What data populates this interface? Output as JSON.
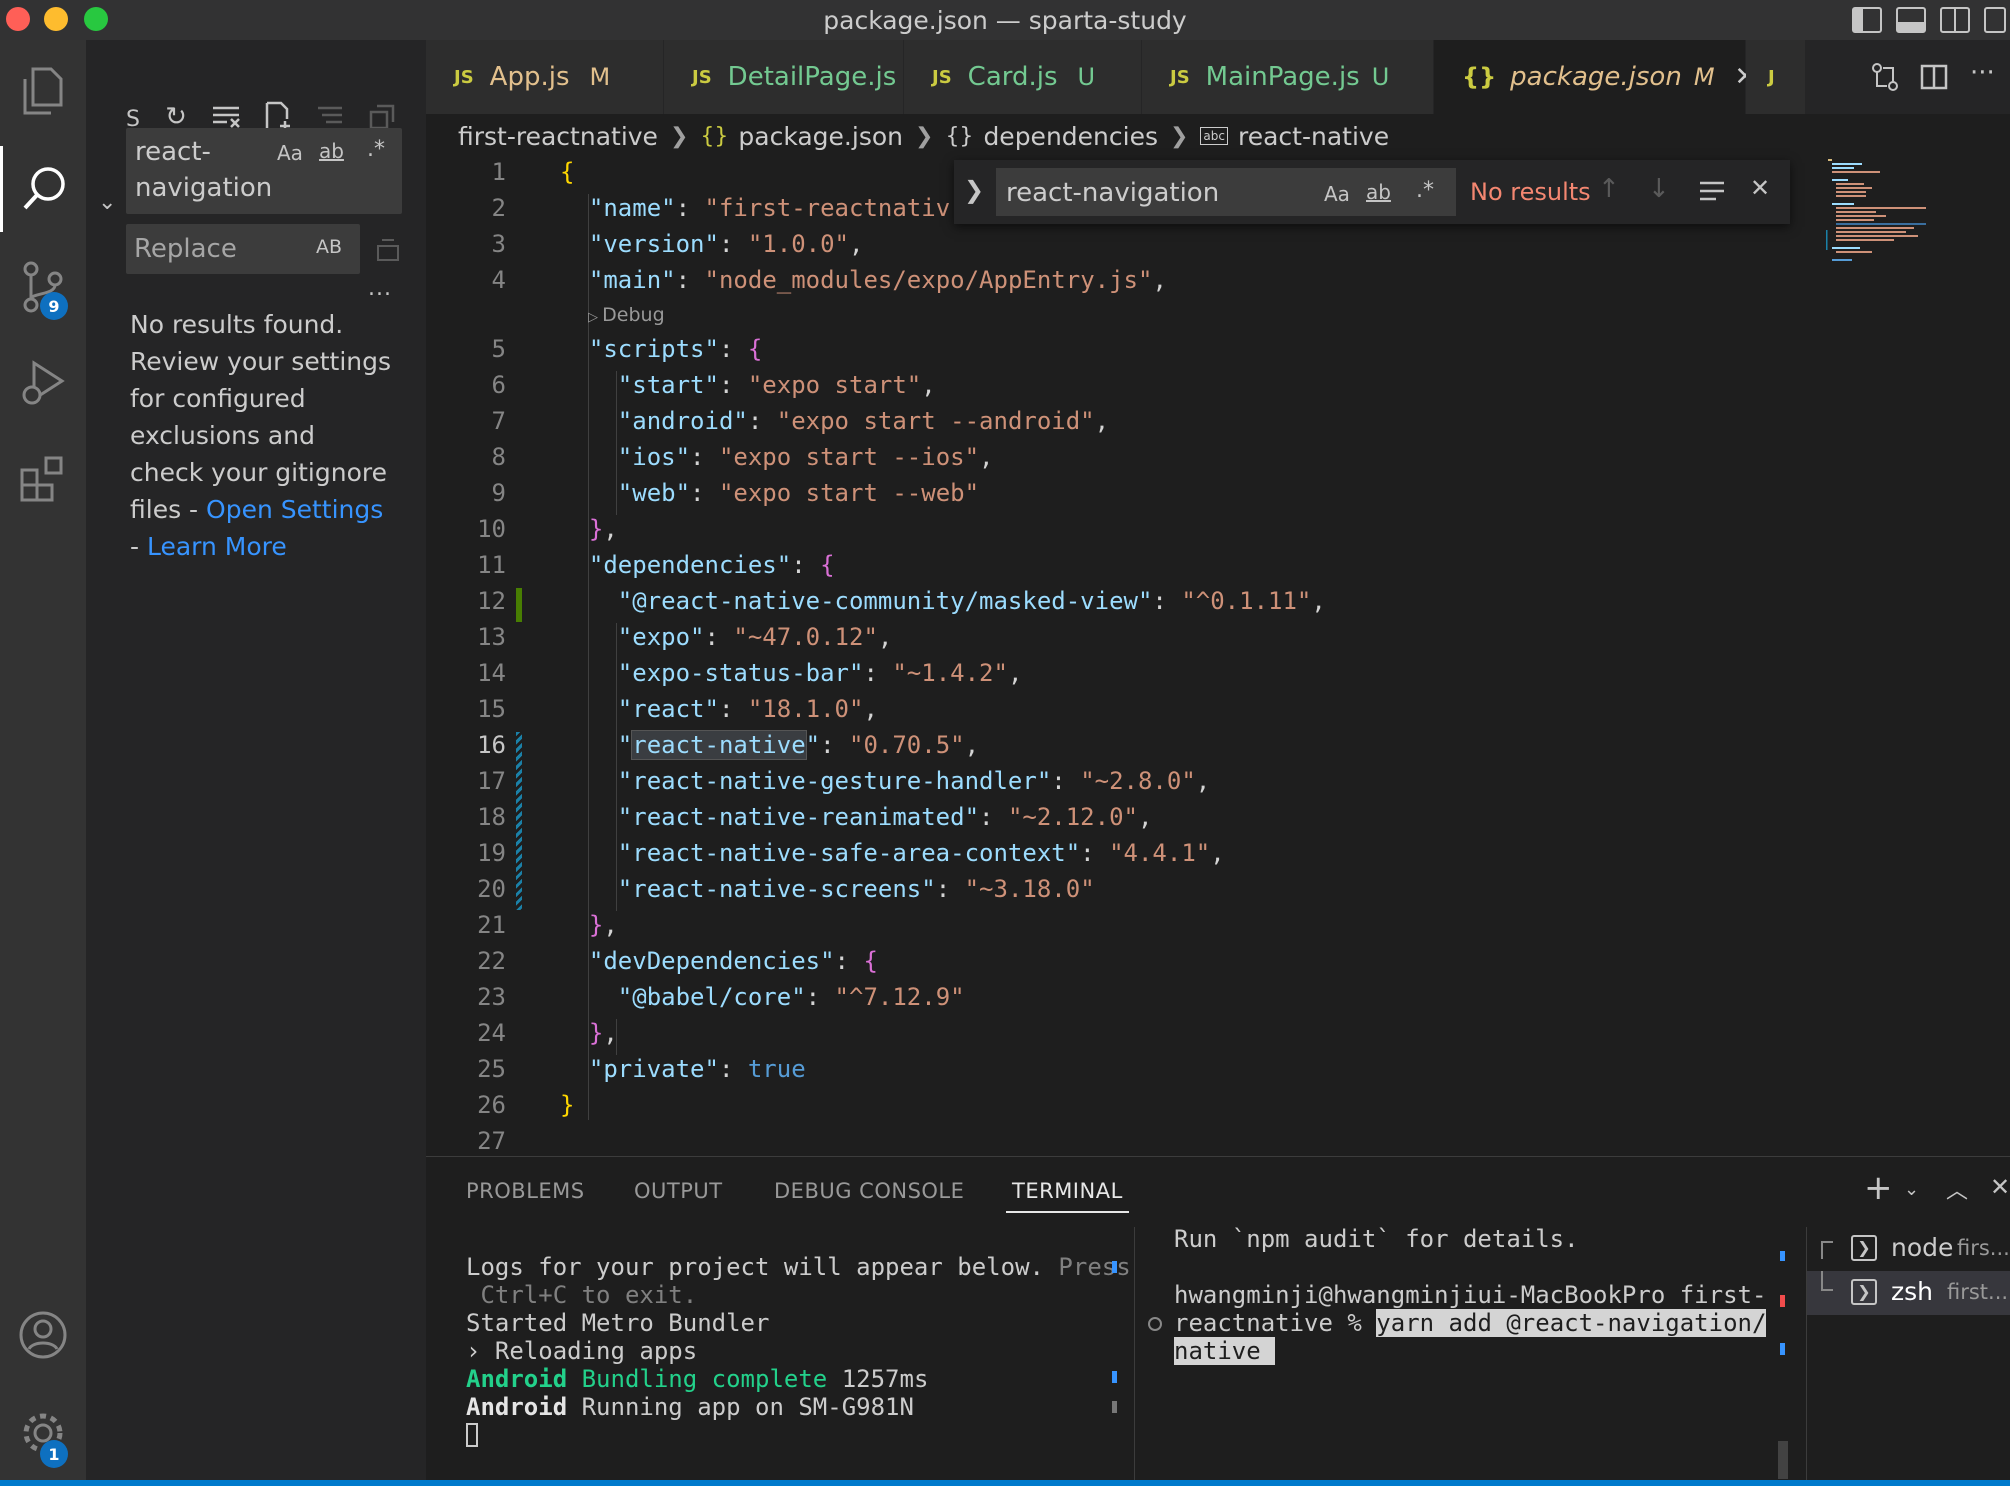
{
  "window": {
    "title": "package.json — sparta-study"
  },
  "colors": {
    "accent": "#007acc",
    "badge": "#0e70c0",
    "modified": "#e2c08d",
    "untracked": "#73c991",
    "link": "#3794ff",
    "no_results": "#f48771"
  },
  "activity_bar": {
    "icons": [
      "explorer-icon",
      "search-icon",
      "source-control-icon",
      "run-debug-icon",
      "extensions-icon",
      "account-icon",
      "settings-gear-icon"
    ],
    "source_control_badge": "9",
    "settings_badge": "1"
  },
  "sidebar": {
    "title_letter": "S",
    "search_value_line1": "react-",
    "search_value_line2": "navigation",
    "match_case": "Aa",
    "whole_word": "ab",
    "regex": ".*",
    "replace_placeholder": "Replace",
    "preserve_case": "AB",
    "more": "...",
    "message_lines": [
      "No results found.",
      "Review your settings",
      "for configured",
      "exclusions and",
      "check your gitignore"
    ],
    "message_last_prefix": "files - ",
    "open_settings": "Open Settings",
    "dash": "- ",
    "learn_more": "Learn More"
  },
  "tabs": [
    {
      "icon": "JS",
      "name": "App.js",
      "status": "M"
    },
    {
      "icon": "JS",
      "name": "DetailPage.js",
      "status": "U"
    },
    {
      "icon": "JS",
      "name": "Card.js",
      "status": "U"
    },
    {
      "icon": "JS",
      "name": "MainPage.js",
      "status": "U"
    },
    {
      "icon": "{}",
      "name": "package.json",
      "status": "M",
      "close": "✕"
    },
    {
      "icon": "J"
    }
  ],
  "breadcrumb": {
    "folder": "first-reactnative",
    "file_icon": "{}",
    "file": "package.json",
    "obj_icon": "{}",
    "obj": "dependencies",
    "prop_icon": "abc",
    "prop": "react-native"
  },
  "editor": {
    "line_numbers": [
      "1",
      "2",
      "3",
      "4",
      "5",
      "6",
      "7",
      "8",
      "9",
      "10",
      "11",
      "12",
      "13",
      "14",
      "15",
      "16",
      "17",
      "18",
      "19",
      "20",
      "21",
      "22",
      "23",
      "24",
      "25",
      "26",
      "27"
    ],
    "current_line": "16",
    "codelens": "Debug",
    "tokens": {
      "l1": "{",
      "l2k": "\"name\"",
      "l2v": "\"first-reactnativ",
      "l3k": "\"version\"",
      "l3v": "\"1.0.0\"",
      "l4k": "\"main\"",
      "l4v": "\"node_modules/expo/AppEntry.js\"",
      "l5k": "\"scripts\"",
      "l5b": "{",
      "l6k": "\"start\"",
      "l6v": "\"expo start\"",
      "l7k": "\"android\"",
      "l7v": "\"expo start --android\"",
      "l8k": "\"ios\"",
      "l8v": "\"expo start --ios\"",
      "l9k": "\"web\"",
      "l9v": "\"expo start --web\"",
      "l10": "}",
      "l11k": "\"dependencies\"",
      "l11b": "{",
      "l12k": "\"@react-native-community/masked-view\"",
      "l12v": "\"^0.1.11\"",
      "l13k": "\"expo\"",
      "l13v": "\"~47.0.12\"",
      "l14k": "\"expo-status-bar\"",
      "l14v": "\"~1.4.2\"",
      "l15k": "\"react\"",
      "l15v": "\"18.1.0\"",
      "l16q1": "\"",
      "l16sel": "react-native",
      "l16q2": "\"",
      "l16v": "\"0.70.5\"",
      "l17k": "\"react-native-gesture-handler\"",
      "l17v": "\"~2.8.0\"",
      "l18k": "\"react-native-reanimated\"",
      "l18v": "\"~2.12.0\"",
      "l19k": "\"react-native-safe-area-context\"",
      "l19v": "\"4.4.1\"",
      "l20k": "\"react-native-screens\"",
      "l20v": "\"~3.18.0\"",
      "l21": "}",
      "l22k": "\"devDependencies\"",
      "l22b": "{",
      "l23k": "\"@babel/core\"",
      "l23v": "\"^7.12.9\"",
      "l24": "}",
      "l25k": "\"private\"",
      "l25v": "true",
      "l26": "}"
    }
  },
  "find_widget": {
    "value": "react-navigation",
    "match_case": "Aa",
    "whole_word": "ab",
    "regex": ".*",
    "result": "No results"
  },
  "panel": {
    "tabs": [
      "PROBLEMS",
      "OUTPUT",
      "DEBUG CONSOLE",
      "TERMINAL"
    ],
    "active_tab": "TERMINAL",
    "left_terminal": {
      "line1a": "Logs for your project will appear below. ",
      "line1b": "Press",
      "line2": " Ctrl+C to exit.",
      "line3": "Started Metro Bundler",
      "line4": "› Reloading apps",
      "line5a": "Android",
      "line5b": " Bundling complete",
      "line5c": " 1257ms",
      "line6a": "Android",
      "line6b": " Running app on SM-G981N"
    },
    "right_terminal": {
      "line1": "Run `npm audit` for details.",
      "line2": "hwangminji@hwangminjiui-MacBookPro first-",
      "line3a": "reactnative % ",
      "line3b": "yarn add @react-navigation/",
      "line4": "native "
    },
    "terminals": [
      {
        "name": "node",
        "detail": "firs..."
      },
      {
        "name": "zsh",
        "detail": "first..."
      }
    ]
  }
}
